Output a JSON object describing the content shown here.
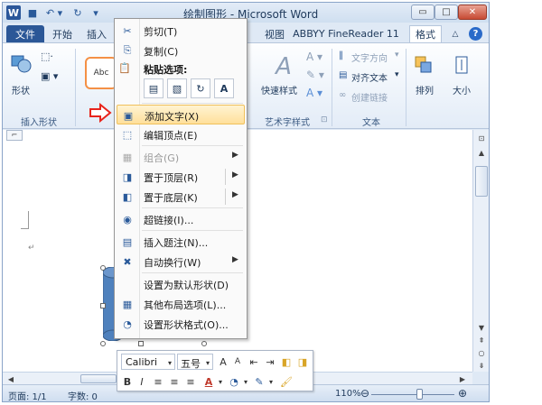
{
  "window": {
    "title": "绘制图形 - Microsoft Word",
    "quick_access": {
      "logo": "W",
      "save": "■",
      "undo": "↶ ▾",
      "redo": "↻",
      "customize": "▾"
    },
    "controls": {
      "minimize": "▭",
      "maximize": "□",
      "close": "✕"
    }
  },
  "tabs": {
    "file": "文件",
    "home": "开始",
    "insert": "插入",
    "view": "视图",
    "abbyy": "ABBYY FineReader 11",
    "format": "格式",
    "ribbon_toggle": "△",
    "help": "?"
  },
  "ribbon": {
    "insert_shapes": {
      "shapes_label": "形状",
      "group_label": "插入形状"
    },
    "shape_styles": {
      "sample": "Abc"
    },
    "wordart": {
      "quick_styles": "快速样式",
      "group_label": "艺术字样式",
      "launcher": "⊡"
    },
    "text": {
      "direction": "文字方向",
      "align": "对齐文本",
      "link": "创建链接",
      "group_label": "文本"
    },
    "arrange": {
      "label": "排列"
    },
    "size": {
      "label": "大小"
    }
  },
  "context_menu": {
    "items": [
      {
        "icon": "✂",
        "label": "剪切(T)"
      },
      {
        "icon": "⎘",
        "label": "复制(C)"
      },
      {
        "icon": "▣",
        "label": "添加文字(X)"
      },
      {
        "icon": "⬚",
        "label": "编辑顶点(E)"
      },
      {
        "icon": "▦",
        "label": "组合(G)",
        "arrow": "▶"
      },
      {
        "icon": "◨",
        "label": "置于顶层(R)",
        "arrow": "▶"
      },
      {
        "icon": "◧",
        "label": "置于底层(K)",
        "arrow": "▶"
      },
      {
        "icon": "◉",
        "label": "超链接(I)..."
      },
      {
        "icon": "▤",
        "label": "插入题注(N)..."
      },
      {
        "icon": "✖",
        "label": "自动换行(W)",
        "arrow": "▶"
      },
      {
        "icon": "",
        "label": "设置为默认形状(D)"
      },
      {
        "icon": "▦",
        "label": "其他布局选项(L)..."
      },
      {
        "icon": "◔",
        "label": "设置形状格式(O)..."
      }
    ],
    "paste_header": "粘贴选项:",
    "paste_options": [
      "▤",
      "▧",
      "↻",
      "A"
    ]
  },
  "mini_toolbar": {
    "font": "Calibri",
    "size": "五号",
    "grow": "A",
    "shrink": "A",
    "bold": "B",
    "italic": "I",
    "font_color": "A"
  },
  "status": {
    "page": "页面: 1/1",
    "words": "字数: 0",
    "zoom": "110%",
    "zoom_minus": "⊖",
    "zoom_plus": "⊕"
  },
  "colors": {
    "file_tab": "#2b5797",
    "highlight": "#ffe09b",
    "arrow": "#e8241c",
    "cylinder": "#4f81bd"
  }
}
